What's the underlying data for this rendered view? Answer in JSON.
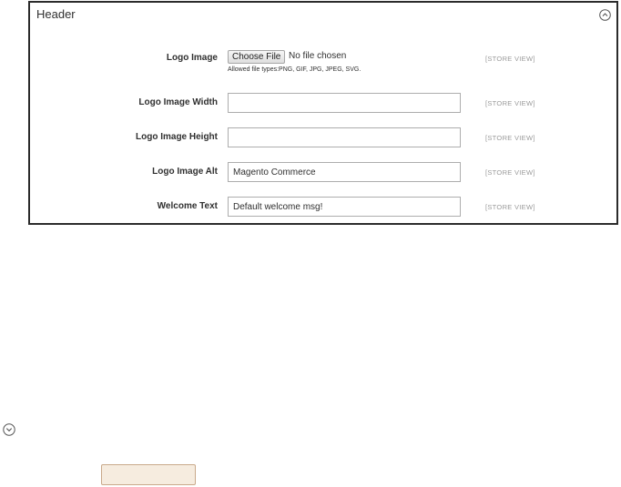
{
  "section": {
    "title": "Header",
    "collapse_icon": "chevron-up-circle-icon"
  },
  "fields": {
    "logo_image": {
      "label": "Logo Image",
      "button_label": "Choose File",
      "status": "No file chosen",
      "note": "Allowed file types:PNG, GIF, JPG, JPEG, SVG.",
      "scope": "[STORE VIEW]"
    },
    "logo_width": {
      "label": "Logo Image Width",
      "value": "",
      "scope": "[STORE VIEW]"
    },
    "logo_height": {
      "label": "Logo Image Height",
      "value": "",
      "scope": "[STORE VIEW]"
    },
    "logo_alt": {
      "label": "Logo Image Alt",
      "value": "Magento Commerce",
      "scope": "[STORE VIEW]"
    },
    "welcome_text": {
      "label": "Welcome Text",
      "value": "Default welcome msg!",
      "scope": "[STORE VIEW]"
    }
  },
  "outside": {
    "expand_icon": "chevron-down-circle-icon",
    "button_label": ""
  },
  "colors": {
    "border": "#2b2b2b",
    "input_border": "#adadad",
    "scope_text": "#9a9a9a",
    "button_fill": "#f6ecdf",
    "button_border": "#c9a98a"
  }
}
